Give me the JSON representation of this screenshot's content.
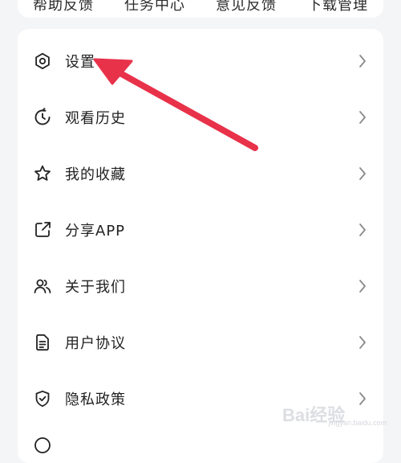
{
  "top_tabs": [
    {
      "label": "帮助反馈"
    },
    {
      "label": "任务中心"
    },
    {
      "label": "意见反馈"
    },
    {
      "label": "下载管理"
    }
  ],
  "menu": {
    "items": [
      {
        "label": "设置",
        "icon": "gear-icon"
      },
      {
        "label": "观看历史",
        "icon": "history-clock-icon"
      },
      {
        "label": "我的收藏",
        "icon": "star-icon"
      },
      {
        "label": "分享APP",
        "icon": "share-icon"
      },
      {
        "label": "关于我们",
        "icon": "users-icon"
      },
      {
        "label": "用户协议",
        "icon": "document-icon"
      },
      {
        "label": "隐私政策",
        "icon": "shield-icon"
      }
    ]
  },
  "watermark": {
    "text": "Bai经验",
    "sub": "jingyan.baidu.com"
  },
  "colors": {
    "accent_arrow": "#e8324a",
    "background": "#f4f5f7",
    "card": "#ffffff"
  }
}
